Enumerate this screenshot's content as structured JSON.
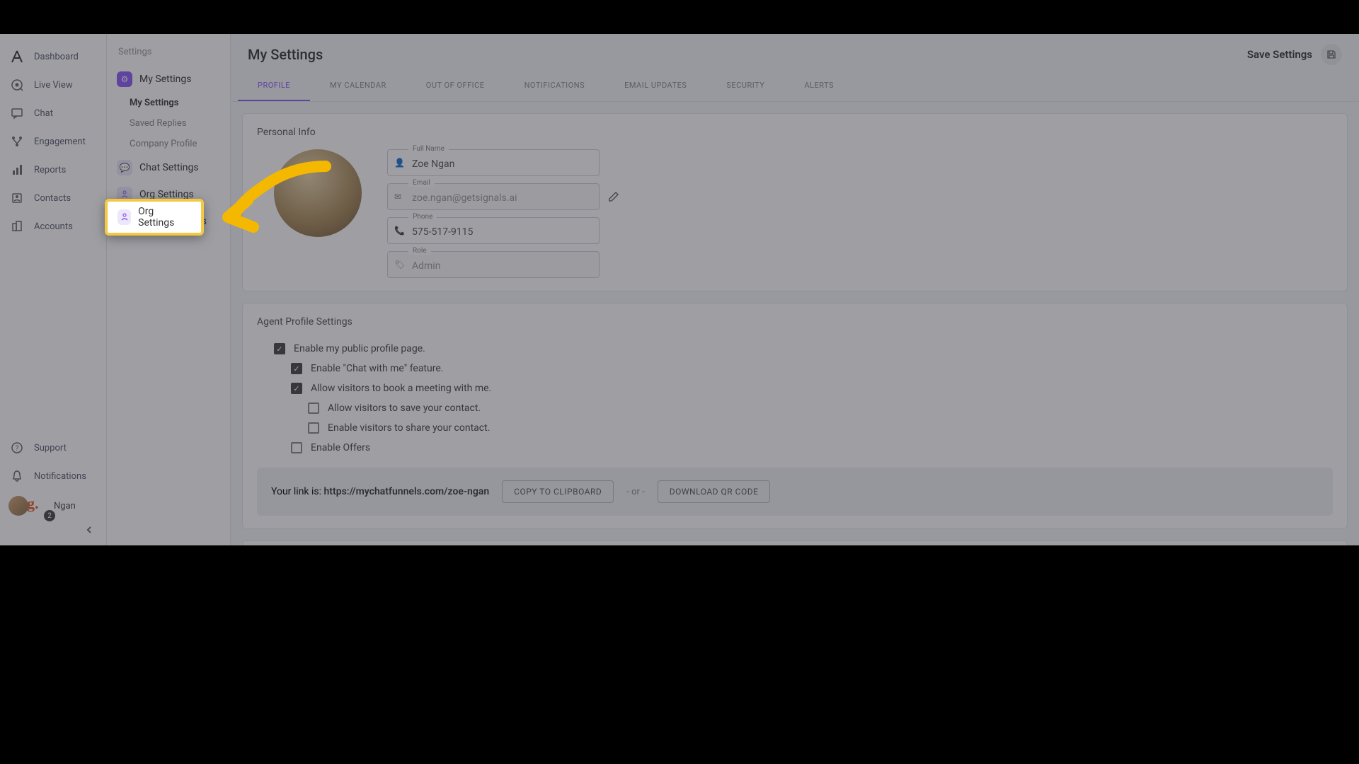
{
  "nav": {
    "items": [
      {
        "label": "Dashboard"
      },
      {
        "label": "Live View"
      },
      {
        "label": "Chat"
      },
      {
        "label": "Engagement"
      },
      {
        "label": "Reports"
      },
      {
        "label": "Contacts"
      },
      {
        "label": "Accounts"
      }
    ],
    "bottom": [
      {
        "label": "Support"
      },
      {
        "label": "Notifications"
      }
    ],
    "user": {
      "name": "Ngan",
      "badge": "2"
    }
  },
  "settings_col": {
    "title": "Settings",
    "groups": [
      {
        "label": "My Settings",
        "icon": "gear",
        "subs": [
          {
            "label": "My Settings",
            "active": true
          },
          {
            "label": "Saved Replies"
          },
          {
            "label": "Company Profile"
          }
        ]
      },
      {
        "label": "Chat Settings",
        "icon": "chat"
      },
      {
        "label": "Org Settings",
        "icon": "org"
      },
      {
        "label": "Admin Settings",
        "icon": "admin"
      }
    ]
  },
  "header": {
    "title": "My Settings",
    "save": "Save Settings"
  },
  "tabs": [
    {
      "label": "PROFILE",
      "active": true
    },
    {
      "label": "MY CALENDAR"
    },
    {
      "label": "OUT OF OFFICE"
    },
    {
      "label": "NOTIFICATIONS"
    },
    {
      "label": "EMAIL UPDATES"
    },
    {
      "label": "SECURITY"
    },
    {
      "label": "ALERTS"
    }
  ],
  "personal": {
    "title": "Personal Info",
    "full_name_label": "Full Name",
    "full_name": "Zoe Ngan",
    "email_label": "Email",
    "email": "zoe.ngan@getsignals.ai",
    "phone_label": "Phone",
    "phone": "575-517-9115",
    "role_label": "Role",
    "role": "Admin"
  },
  "agent": {
    "title": "Agent Profile Settings",
    "opts": [
      {
        "label": "Enable my public profile page.",
        "checked": true,
        "indent": 1
      },
      {
        "label": "Enable \"Chat with me\" feature.",
        "checked": true,
        "indent": 2
      },
      {
        "label": "Allow visitors to book a meeting with me.",
        "checked": true,
        "indent": 2
      },
      {
        "label": "Allow visitors to save your contact.",
        "checked": false,
        "indent": 3
      },
      {
        "label": "Enable visitors to share your contact.",
        "checked": false,
        "indent": 3
      },
      {
        "label": "Enable Offers",
        "checked": false,
        "indent": 2
      }
    ],
    "link_prefix": "Your link is: ",
    "link_url": "https://mychatfunnels.com/zoe-ngan",
    "copy": "COPY TO CLIPBOARD",
    "or": "- or -",
    "download": "DOWNLOAD QR CODE"
  },
  "highlight": {
    "label": "Org Settings"
  }
}
